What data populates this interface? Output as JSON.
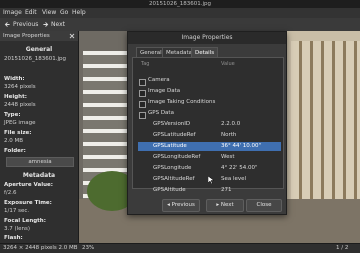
{
  "window": {
    "title": "20151026_183601.jpg"
  },
  "menu": [
    "Image",
    "Edit",
    "View",
    "Go",
    "Help"
  ],
  "toolbar": {
    "previous": "Previous",
    "next": "Next"
  },
  "sidebar": {
    "header": "Image Properties",
    "general_title": "General",
    "name_value": "20151026_183601.jpg",
    "width_label": "Width:",
    "width_value": "3264 pixels",
    "height_label": "Height:",
    "height_value": "2448 pixels",
    "type_label": "Type:",
    "type_value": "JPEG image",
    "filesize_label": "File size:",
    "filesize_value": "2.0 MB",
    "folder_label": "Folder:",
    "folder_value": "amnesia",
    "metadata_title": "Metadata",
    "aperture_label": "Aperture Value:",
    "aperture_value": "f/2.6",
    "exposure_label": "Exposure Time:",
    "exposure_value": "1/17 sec.",
    "focal_label": "Focal Length:",
    "focal_value": "3.7 (lens)",
    "flash_label": "Flash:"
  },
  "status": {
    "info": "3264 × 2448 pixels  2.0 MB",
    "zoom": "23%",
    "page": "1 / 2"
  },
  "dialog": {
    "title": "Image Properties",
    "tabs": [
      "General",
      "Metadata",
      "Details"
    ],
    "col_tag": "Tag",
    "col_value": "Value",
    "sections": [
      "Camera",
      "Image Data",
      "Image Taking Conditions",
      "GPS Data"
    ],
    "gps_rows": [
      {
        "tag": "GPSVersionID",
        "value": "2.2.0.0"
      },
      {
        "tag": "GPSLatitudeRef",
        "value": "North"
      },
      {
        "tag": "GPSLatitude",
        "value": "36° 44' 10.00\""
      },
      {
        "tag": "GPSLongitudeRef",
        "value": "West"
      },
      {
        "tag": "GPSLongitude",
        "value": "4° 22' 54.00\""
      },
      {
        "tag": "GPSAltitudeRef",
        "value": "Sea level"
      },
      {
        "tag": "GPSAltitude",
        "value": "271"
      }
    ],
    "buttons": {
      "previous": "Previous",
      "next": "Next",
      "close": "Close"
    }
  }
}
